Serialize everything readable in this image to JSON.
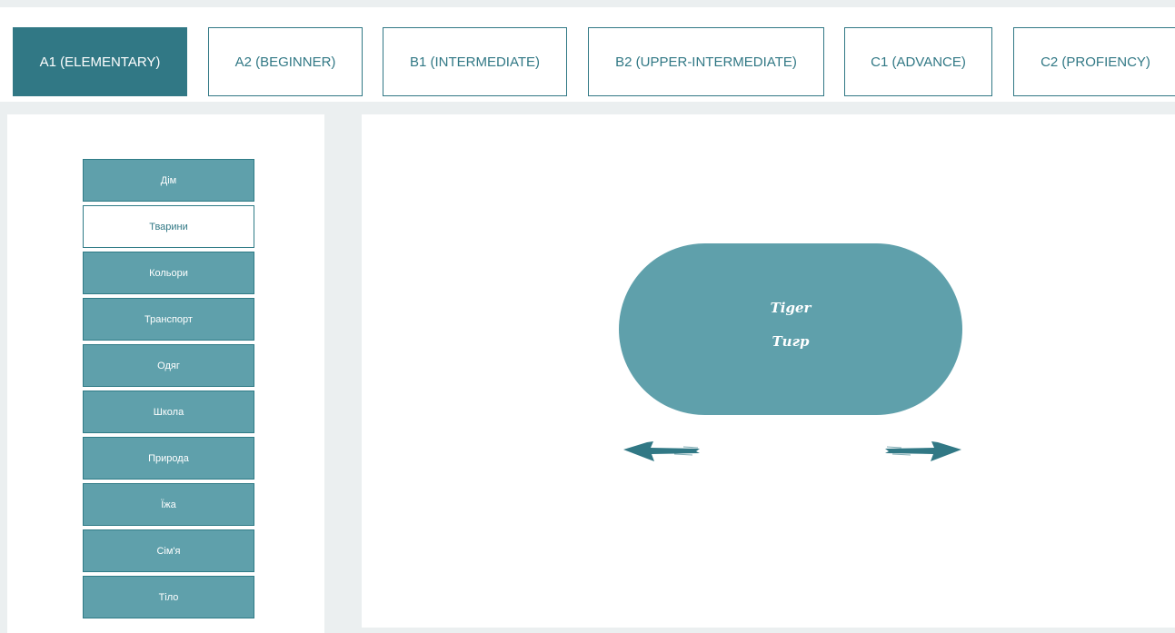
{
  "tabs": [
    {
      "label": "A1 (ELEMENTARY)",
      "active": true
    },
    {
      "label": "A2 (BEGINNER)",
      "active": false
    },
    {
      "label": "B1 (INTERMEDIATE)",
      "active": false
    },
    {
      "label": "B2 (UPPER-INTERMEDIATE)",
      "active": false
    },
    {
      "label": "C1 (ADVANCE)",
      "active": false
    },
    {
      "label": "C2 (PROFIENCY)",
      "active": false
    }
  ],
  "categories": [
    {
      "label": "Дім",
      "active": false
    },
    {
      "label": "Тварини",
      "active": true
    },
    {
      "label": "Кольори",
      "active": false
    },
    {
      "label": "Транспорт",
      "active": false
    },
    {
      "label": "Одяг",
      "active": false
    },
    {
      "label": "Школа",
      "active": false
    },
    {
      "label": "Природа",
      "active": false
    },
    {
      "label": "Їжа",
      "active": false
    },
    {
      "label": "Сім'я",
      "active": false
    },
    {
      "label": "Тіло",
      "active": false
    }
  ],
  "card": {
    "word": "Tiger",
    "translation": "Тигр"
  },
  "nav": {
    "prev_icon": "arrow-left-icon",
    "next_icon": "arrow-right-icon"
  },
  "colors": {
    "accent": "#317885",
    "button": "#5fa0ab",
    "background": "#ebeff0"
  }
}
